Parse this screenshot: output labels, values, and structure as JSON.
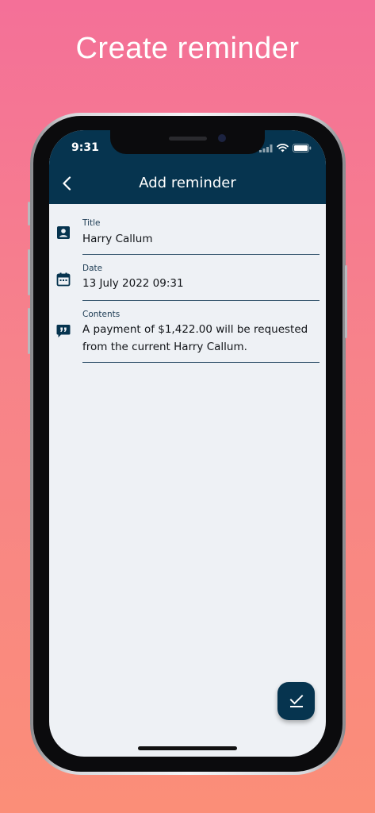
{
  "promo": {
    "title": "Create reminder"
  },
  "status_bar": {
    "time": "9:31"
  },
  "app_bar": {
    "title": "Add reminder",
    "back_icon": "chevron-left-icon"
  },
  "form": {
    "title_field": {
      "label": "Title",
      "value": "Harry Callum",
      "icon": "contact-card-icon"
    },
    "date_field": {
      "label": "Date",
      "value": "13 July 2022 09:31",
      "icon": "calendar-icon"
    },
    "contents_field": {
      "label": "Contents",
      "value": "A payment of $1,422.00 will be requested from the current Harry Callum.",
      "icon": "quote-comment-icon"
    }
  },
  "fab": {
    "icon": "check-done-icon"
  },
  "colors": {
    "app_bar": "#06344f",
    "screen_background": "#eef1f5",
    "accent": "#06344f",
    "gradient_top": "#f47098",
    "gradient_bottom": "#fb8e78"
  }
}
